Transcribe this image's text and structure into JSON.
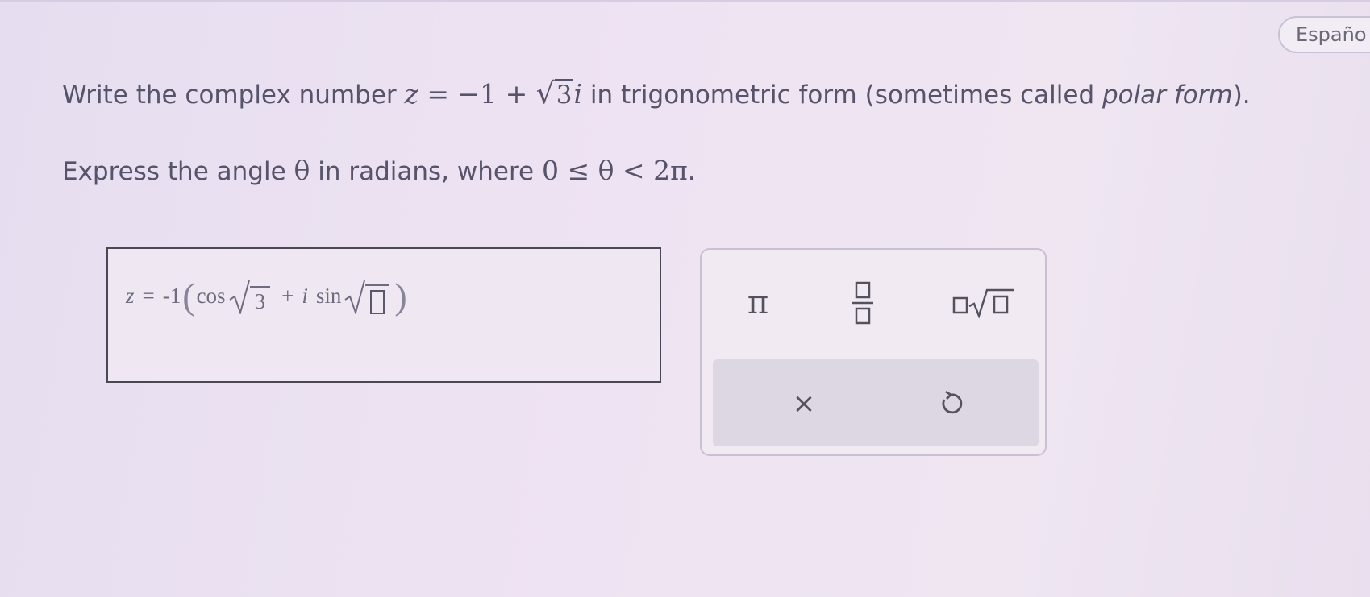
{
  "language_button": {
    "label": "Españo"
  },
  "question": {
    "line1_prefix": "Write the complex number ",
    "z_var": "z",
    "eq_minus_one": " = −1 + ",
    "sqrt_radicand": "3",
    "imag_unit": "i",
    "line1_middle": " in trigonometric form (sometimes called ",
    "emphasis": "polar form",
    "line1_suffix": ").",
    "line2_prefix": "Express the angle ",
    "theta": "θ",
    "line2_middle": " in radians, where ",
    "constraint": "0 ≤ θ < 2π",
    "line2_suffix": "."
  },
  "answer": {
    "z_var": "z",
    "equals": "=",
    "coefficient": "-1",
    "cos_label": "cos",
    "cos_arg": "3",
    "plus": "+",
    "imag_unit": "i",
    "sin_label": "sin"
  },
  "keypad": {
    "pi_label": "π",
    "fraction_icon": "fraction-template-icon",
    "nroot_icon": "nth-root-template-icon",
    "clear_label": "×",
    "undo_icon": "undo-icon"
  }
}
